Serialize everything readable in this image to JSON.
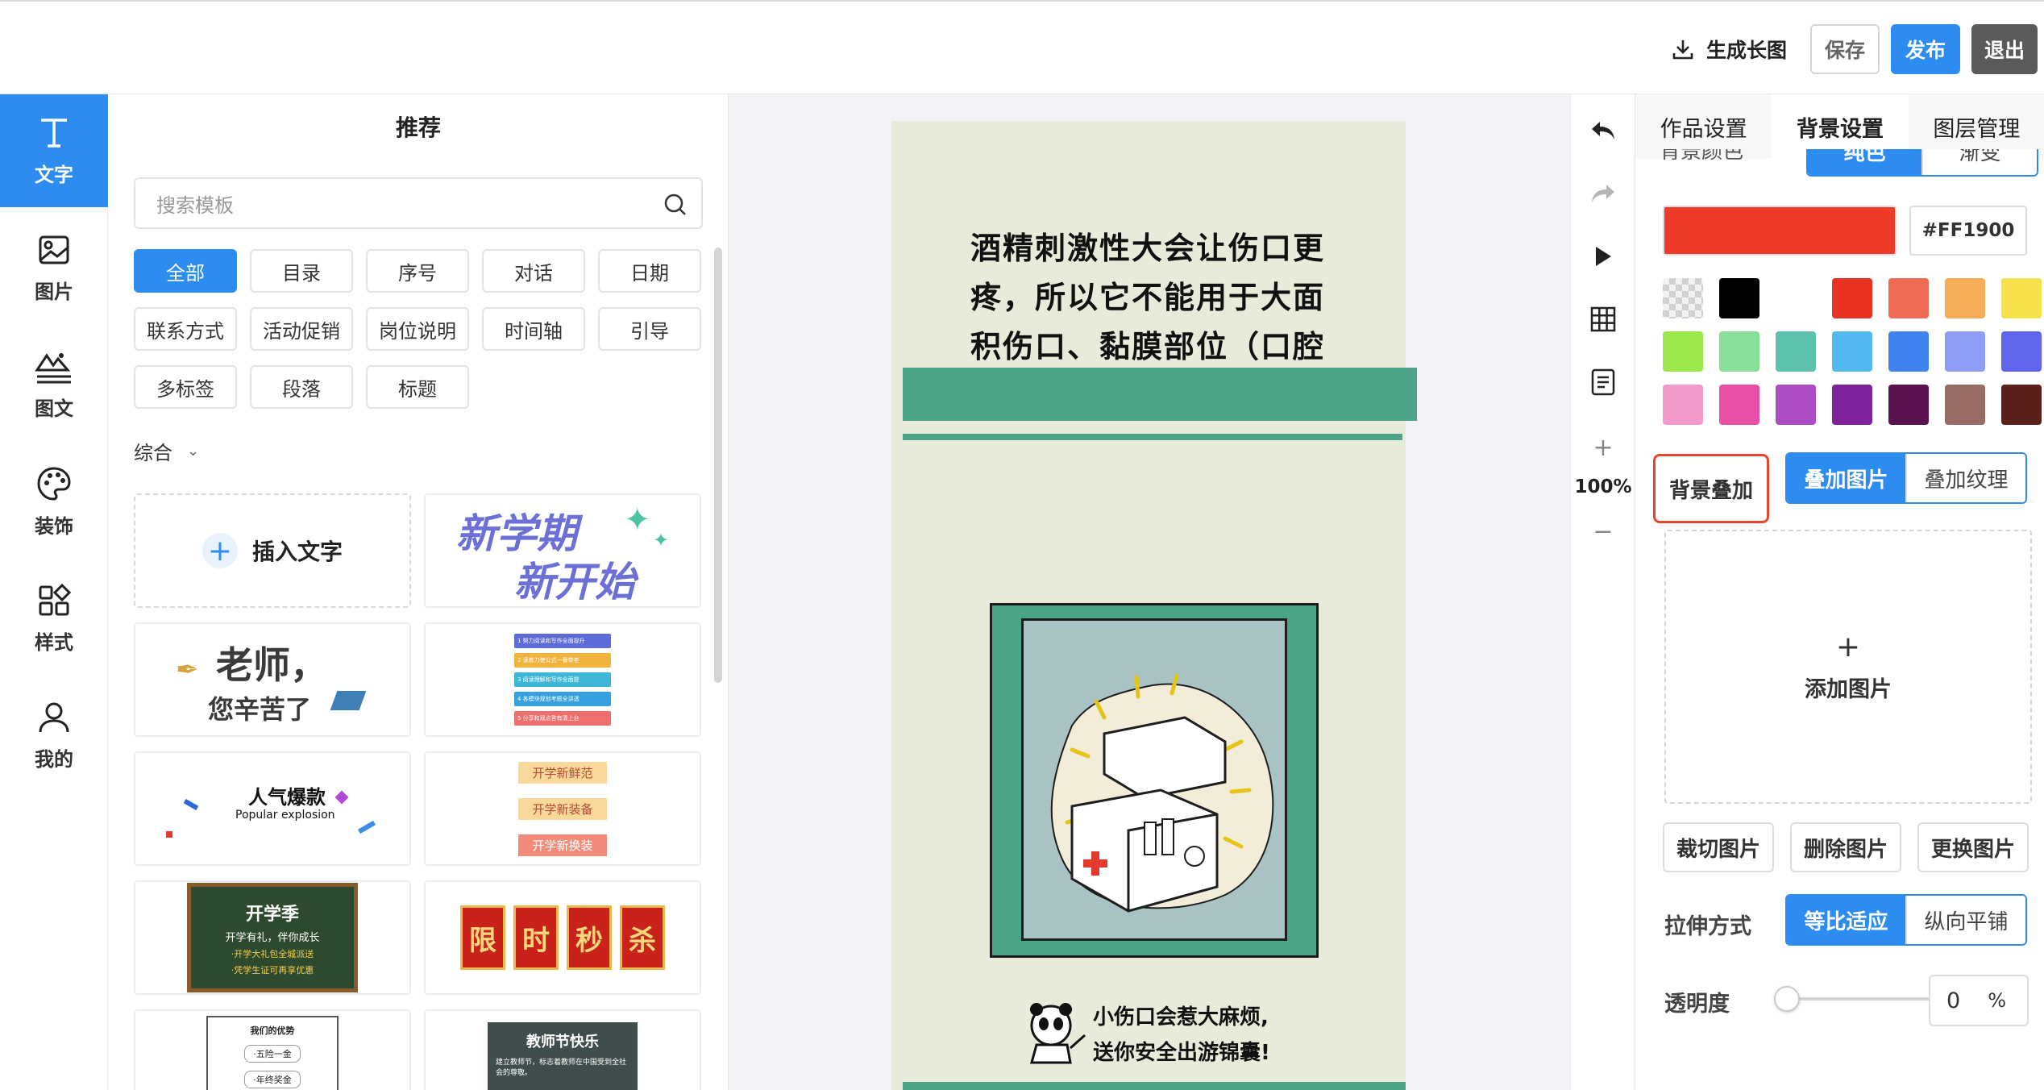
{
  "header": {
    "generate_label": "生成长图",
    "save_label": "保存",
    "publish_label": "发布",
    "exit_label": "退出"
  },
  "nav": [
    {
      "label": "文字",
      "icon": "text-icon"
    },
    {
      "label": "图片",
      "icon": "image-icon"
    },
    {
      "label": "图文",
      "icon": "image-text-icon"
    },
    {
      "label": "装饰",
      "icon": "palette-icon"
    },
    {
      "label": "样式",
      "icon": "style-icon"
    },
    {
      "label": "我的",
      "icon": "user-icon"
    }
  ],
  "template_panel": {
    "title": "推荐",
    "search_placeholder": "搜索模板",
    "categories": [
      "全部",
      "目录",
      "序号",
      "对话",
      "日期",
      "联系方式",
      "活动促销",
      "岗位说明",
      "时间轴",
      "引导",
      "多标签",
      "段落",
      "标题"
    ],
    "active_category": "全部",
    "filter_label": "综合",
    "insert_text_label": "插入文字",
    "cards": [
      {
        "lines": [
          "新学期",
          "新开始"
        ]
      },
      {
        "lines": [
          "1 努力阅读和写作全面提升",
          "2 读着力使公式一番带老",
          "3 阅读理解和写作全面提",
          "4 各模块规划考题全讲透",
          "5 分享和观点答有清上台"
        ]
      },
      {
        "lines": [
          "老师，",
          "您辛苦了"
        ]
      },
      {
        "lines": [
          "开学新鲜范",
          "开学新装备",
          "开学新换装"
        ]
      },
      {
        "lines": [
          "人气爆款",
          "Popular explosion"
        ]
      },
      {
        "lines": [
          "限",
          "时",
          "秒",
          "杀"
        ]
      },
      {
        "lines": [
          "开学季",
          "开学有礼，伴你成长",
          "·开学大礼包全城派送",
          "·凭学生证可再享优惠"
        ]
      },
      {
        "lines": [
          "教师节快乐",
          "建立教师节，标志着教师在中国受到全社会的尊敬。"
        ]
      },
      {
        "lines": [
          "我们的优势",
          "·五险一金",
          "·年终奖金"
        ]
      }
    ]
  },
  "canvas": {
    "headline": "酒精刺激性大会让伤口更疼，所以它不能用于大面积伤口、黏膜部位（口腔",
    "caption_line1": "小伤口会惹大麻烦,",
    "caption_line2": "送你安全出游锦囊!"
  },
  "tools": {
    "zoom": "100%"
  },
  "right_panel": {
    "tabs": [
      "作品设置",
      "背景设置",
      "图层管理"
    ],
    "active_tab": "背景设置",
    "bg_color_label": "背景颜色",
    "fill_options": [
      "纯色",
      "渐变"
    ],
    "hex_value": "#FF1900",
    "current_color": "#ee3a26",
    "swatches": [
      "transparent",
      "#000000",
      "#ffffff",
      "#e8321f",
      "#ee6a55",
      "#f5ae55",
      "#f6e04b",
      "#9be94a",
      "#86e099",
      "#5dc2ad",
      "#52b8ef",
      "#3e83ef",
      "#8f9ef5",
      "#6266ef",
      "#f39acb",
      "#e94fa6",
      "#ac4dc4",
      "#7f239c",
      "#5a1250",
      "#9a6b66",
      "#5b1f1c"
    ],
    "overlay_label": "背景叠加",
    "overlay_options": [
      "叠加图片",
      "叠加纹理"
    ],
    "add_image_label": "添加图片",
    "actions": [
      "裁切图片",
      "删除图片",
      "更换图片"
    ],
    "stretch_label": "拉伸方式",
    "stretch_options": [
      "等比适应",
      "纵向平铺"
    ],
    "opacity_label": "透明度",
    "opacity_value": "0",
    "opacity_unit": "%"
  }
}
